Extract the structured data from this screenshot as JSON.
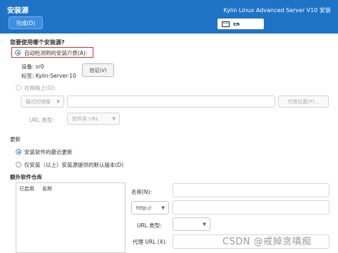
{
  "header": {
    "title": "安装源",
    "done_label": "完成(D)",
    "product": "Kylin Linux Advanced Server V10 安装",
    "keyboard_icon": "keyboard-icon",
    "keyboard_layout": "cn",
    "brand_color": "#1f73c7"
  },
  "source": {
    "question": "您要使用哪个安装源?",
    "auto_detect_label": "自动检测到的安装介质(A):",
    "device_label": "设备: sr0",
    "label_label": "标签: Kylin-Server-10",
    "verify_label": "验证(V)",
    "network_label": "在网络上(O):",
    "mirror_select": "最近的镜像",
    "proxy_label": "代理设置(P)...",
    "url_type_label": "URL 类型:",
    "url_type_select": "软件库 URL"
  },
  "updates": {
    "title": "更新",
    "latest_label": "安装软件的最近更新",
    "only_label": "仅安装（以上）安装源提供的默认版本(D)"
  },
  "repos": {
    "title": "额外软件仓库",
    "col_enabled": "已启用",
    "col_name": "名称",
    "name_label": "名称(N):",
    "protocol_select": "http://",
    "url_type_label": "URL 类型:",
    "proxy_url_label": "代理 URL (X):"
  },
  "watermark": "CSDN @戒掉贪嗔痴",
  "highlight_color": "#e0302a"
}
